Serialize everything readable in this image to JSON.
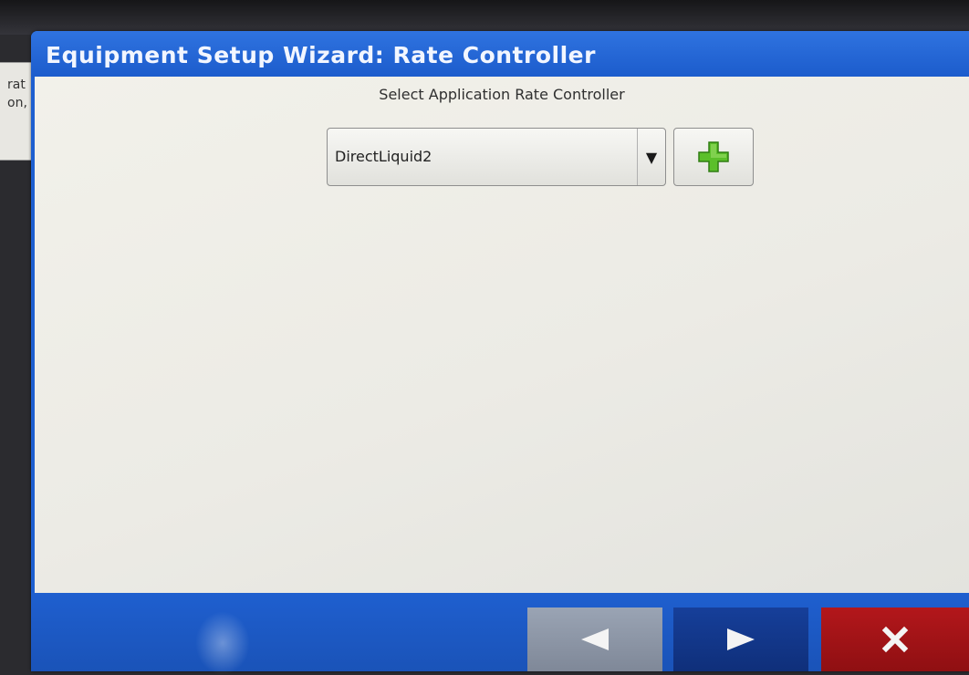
{
  "background_window": {
    "fragment_1": "rat",
    "fragment_2": "on,"
  },
  "dialog": {
    "title": "Equipment Setup Wizard:  Rate Controller",
    "subtitle": "Select Application Rate Controller"
  },
  "rate_controller_select": {
    "selected_value": "DirectLiquid2"
  },
  "icons": {
    "add": "plus-icon",
    "dropdown": "chevron-down-icon",
    "back": "arrow-left-icon",
    "next": "arrow-right-icon",
    "cancel": "close-icon"
  },
  "colors": {
    "title_bar": "#1d5fd0",
    "add_icon": "#5bbf2a",
    "back_button": "#8c95a5",
    "next_button": "#123a8c",
    "cancel_button": "#a11216"
  }
}
